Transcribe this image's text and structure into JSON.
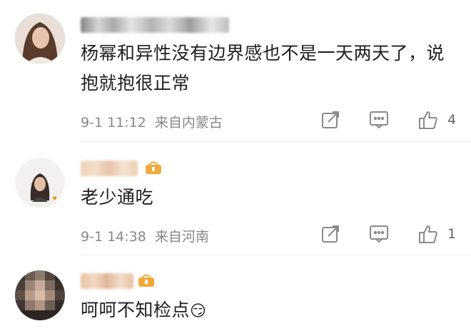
{
  "comments": [
    {
      "content": "杨幂和异性没有边界感也不是一天两天了，说抱就抱很正常",
      "date": "9-1 11:12",
      "location": "来自内蒙古",
      "likes": "4"
    },
    {
      "content": "老少通吃",
      "date": "9-1 14:38",
      "location": "来自河南",
      "likes": "1"
    },
    {
      "content": "呵呵不知检点",
      "emoji": "😏"
    }
  ],
  "icons": {
    "share": "share-icon",
    "reply": "comment-icon",
    "like": "thumbs-up-icon",
    "vip": "vip-crown-icon"
  },
  "colors": {
    "meta_text": "#888888",
    "vip_gold": "#f2a93b",
    "icon_gray": "#8a8a8a"
  }
}
